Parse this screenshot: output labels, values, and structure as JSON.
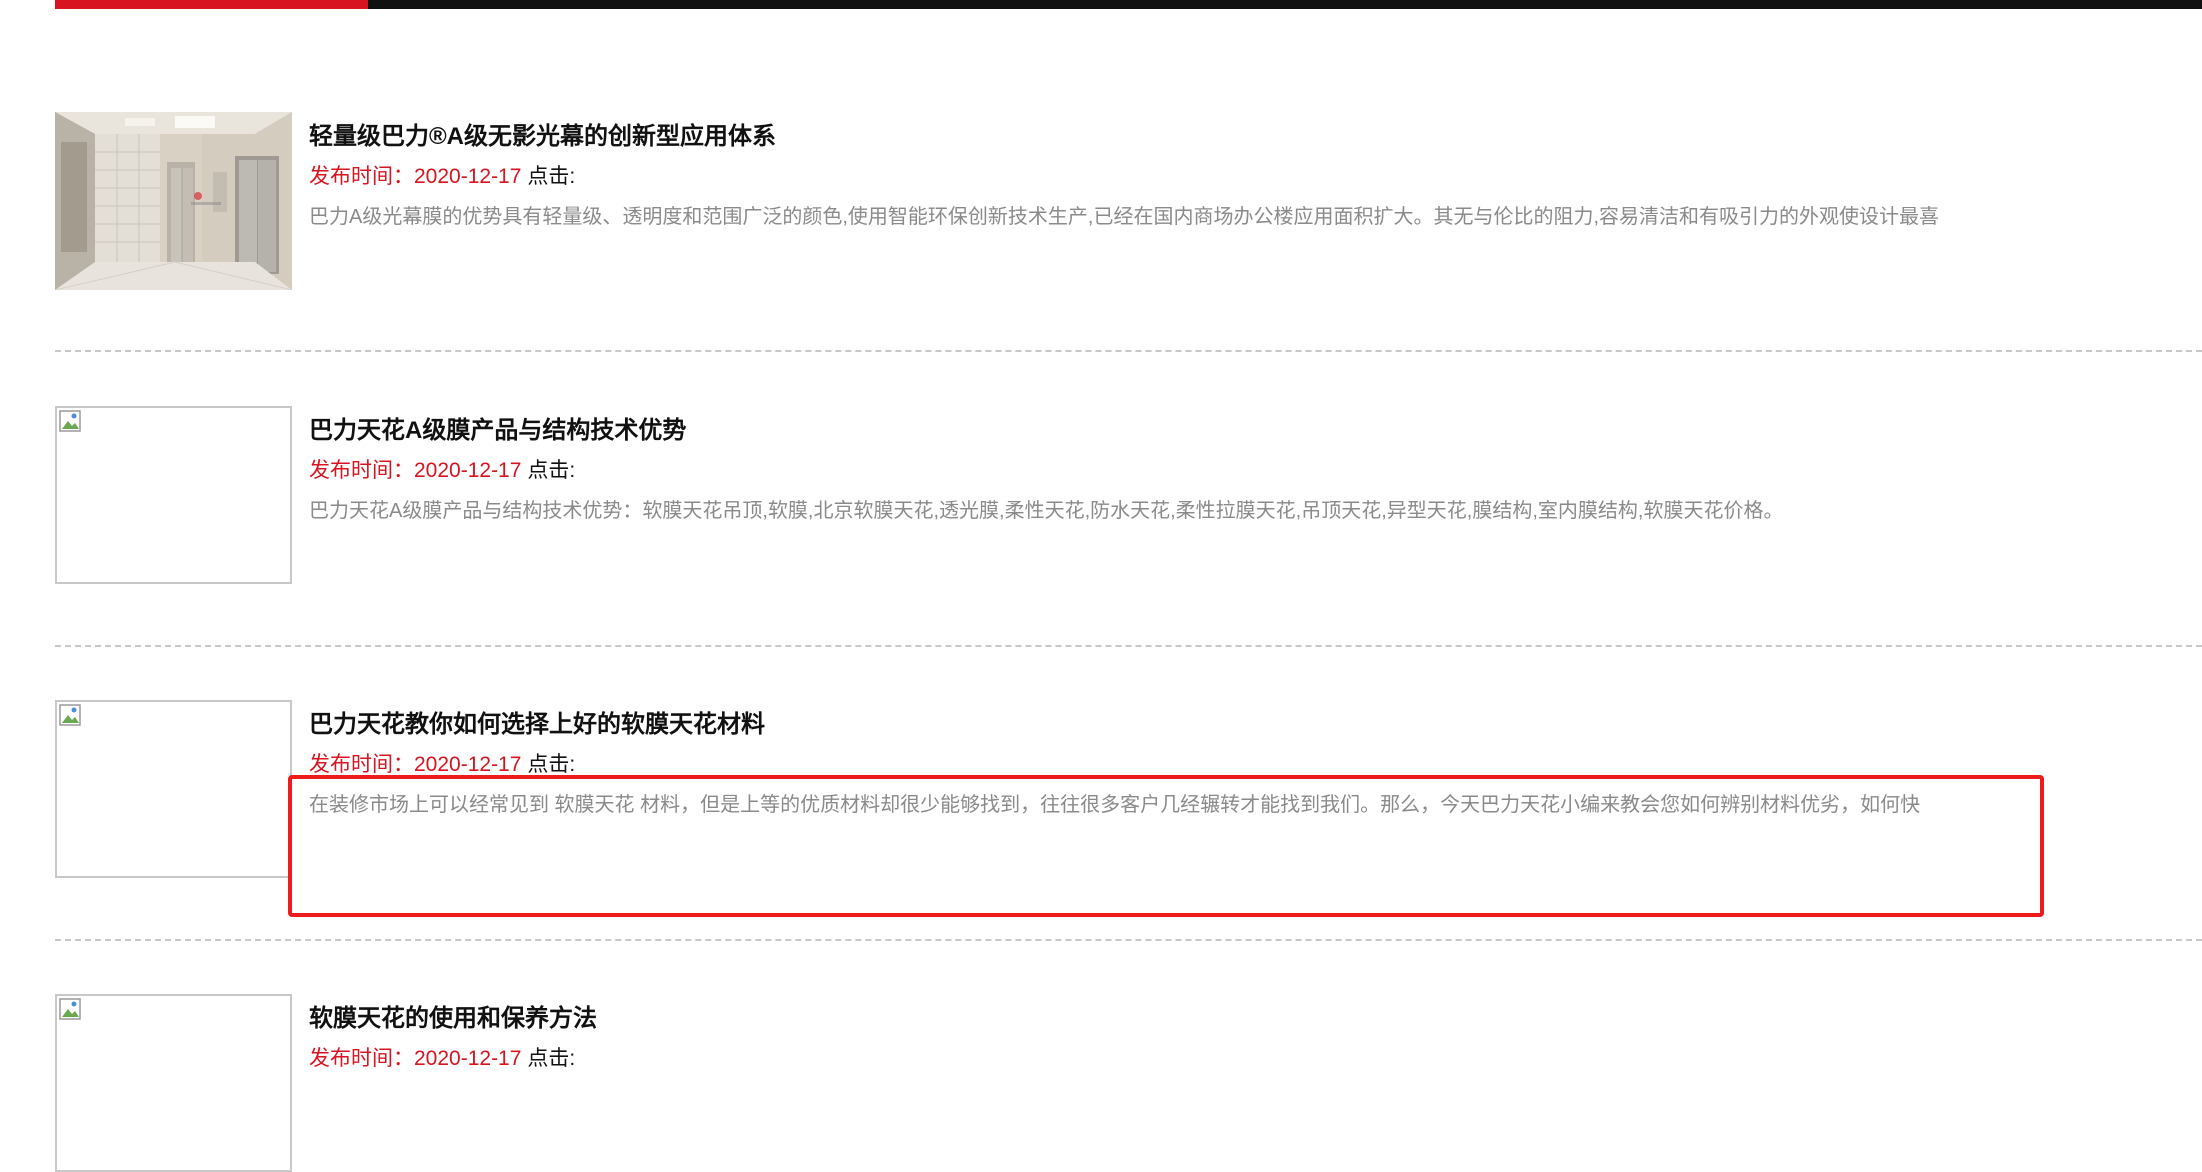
{
  "colors": {
    "accent": "#d7141f",
    "bar": "#111111",
    "summary": "#8a8a8a",
    "highlight": "#ee1c1c"
  },
  "news": [
    {
      "title": "轻量级巴力®A级无影光幕的创新型应用体系",
      "date_label": "发布时间：",
      "date": "2020-12-17",
      "clicks_label": "点击:",
      "summary": "巴力A级光幕膜的优势具有轻量级、透明度和范围广泛的颜色,使用智能环保创新技术生产,已经在国内商场办公楼应用面积扩大。其无与伦比的阻力,容易清洁和有吸引力的外观使设计最喜",
      "thumb": "elevator-lobby-photo"
    },
    {
      "title": "巴力天花A级膜产品与结构技术优势",
      "date_label": "发布时间：",
      "date": "2020-12-17",
      "clicks_label": "点击:",
      "summary": "巴力天花A级膜产品与结构技术优势：软膜天花吊顶,软膜,北京软膜天花,透光膜,柔性天花,防水天花,柔性拉膜天花,吊顶天花,异型天花,膜结构,室内膜结构,软膜天花价格。",
      "thumb": "broken-image-icon"
    },
    {
      "title": "巴力天花教你如何选择上好的软膜天花材料",
      "date_label": "发布时间：",
      "date": "2020-12-17",
      "clicks_label": "点击:",
      "summary": "在装修市场上可以经常见到 软膜天花 材料，但是上等的优质材料却很少能够找到，往往很多客户几经辗转才能找到我们。那么，今天巴力天花小编来教会您如何辨别材料优劣，如何快",
      "thumb": "broken-image-icon"
    },
    {
      "title": "软膜天花的使用和保养方法",
      "date_label": "发布时间：",
      "date": "2020-12-17",
      "clicks_label": "点击:",
      "summary": "",
      "thumb": "broken-image-icon"
    }
  ]
}
